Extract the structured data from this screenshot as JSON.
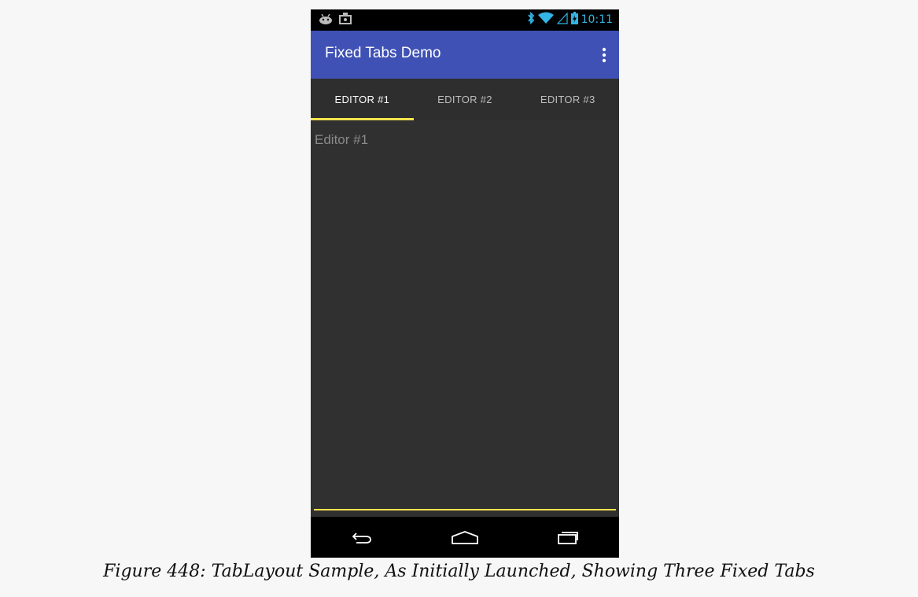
{
  "status_bar": {
    "time": "10:11",
    "icons_left": [
      "android-debug-icon",
      "screenshot-icon"
    ],
    "icons_right": [
      "bluetooth-icon",
      "wifi-icon",
      "signal-icon",
      "battery-charging-icon"
    ]
  },
  "app_bar": {
    "title": "Fixed Tabs Demo",
    "menu_icon": "overflow-menu-icon",
    "color": "#3f51b5"
  },
  "tabs": [
    {
      "label": "EDITOR #1",
      "selected": true
    },
    {
      "label": "EDITOR #2",
      "selected": false
    },
    {
      "label": "EDITOR #3",
      "selected": false
    }
  ],
  "tab_indicator_color": "#ffe34d",
  "editor": {
    "placeholder": "Editor #1"
  },
  "nav_bar": {
    "icons": [
      "back-icon",
      "home-icon",
      "recents-icon"
    ]
  },
  "caption": "Figure 448: TabLayout Sample, As Initially Launched, Showing Three Fixed Tabs"
}
